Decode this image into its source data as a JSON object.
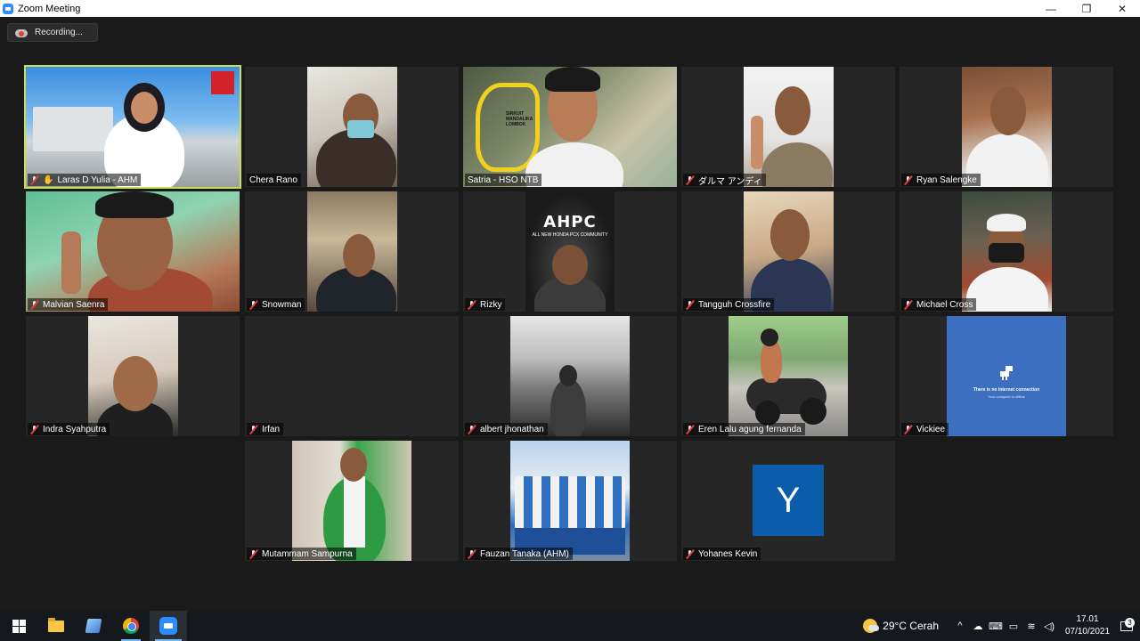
{
  "window": {
    "title": "Zoom Meeting",
    "controls": {
      "minimize": "—",
      "maximize": "❐",
      "close": "✕"
    }
  },
  "recording": {
    "label": "Recording..."
  },
  "participants": [
    {
      "name": "Laras D Yulia - AHM",
      "muted": true,
      "hand_raised": true,
      "active_speaker": true
    },
    {
      "name": "Chera Rano",
      "muted": false
    },
    {
      "name": "Satria - HSO NTB",
      "muted": false
    },
    {
      "name": "ダルマ アンディ",
      "muted": true
    },
    {
      "name": "Ryan Salengke",
      "muted": true
    },
    {
      "name": "Malvian Saenra",
      "muted": true
    },
    {
      "name": "Snowman",
      "muted": true
    },
    {
      "name": "Rizky",
      "muted": true,
      "overlay_title": "AHPC",
      "overlay_sub": "ALL NEW HONDA PCX COMMUNITY"
    },
    {
      "name": "Tangguh Crossfire",
      "muted": true
    },
    {
      "name": "Michael Cross",
      "muted": true
    },
    {
      "name": "Indra Syahputra",
      "muted": true
    },
    {
      "name": "Irfan",
      "muted": true
    },
    {
      "name": "albert jhonathan",
      "muted": true
    },
    {
      "name": "Eren Lalu agung fernanda",
      "muted": true
    },
    {
      "name": "Vickiee",
      "muted": true,
      "overlay_title": "There is no Internet connection",
      "overlay_sub": "Your computer is offline"
    },
    {
      "name": "Mutammam Sampurna",
      "muted": true
    },
    {
      "name": "Fauzan Tanaka (AHM)",
      "muted": true
    },
    {
      "name": "Yohanes Kevin",
      "muted": true,
      "avatar_letter": "Y"
    }
  ],
  "satria_track": {
    "line1": "SIRKUIT",
    "line2": "MANDALIKA",
    "line3": "LOMBOK"
  },
  "taskbar": {
    "apps": [
      "windows-start",
      "file-explorer",
      "notes",
      "chrome",
      "zoom"
    ],
    "weather": "29°C  Cerah",
    "tray_icons": [
      "^",
      "☁",
      "⌨",
      "▭",
      "≋",
      "◁)"
    ],
    "time": "17.01",
    "date": "07/10/2021",
    "notification_count": "3"
  },
  "colors": {
    "active_speaker_border": "#c9e04a",
    "zoom_blue": "#2d8cff",
    "avatar_blue": "#0b5cab",
    "muted_red": "#e0403a"
  }
}
